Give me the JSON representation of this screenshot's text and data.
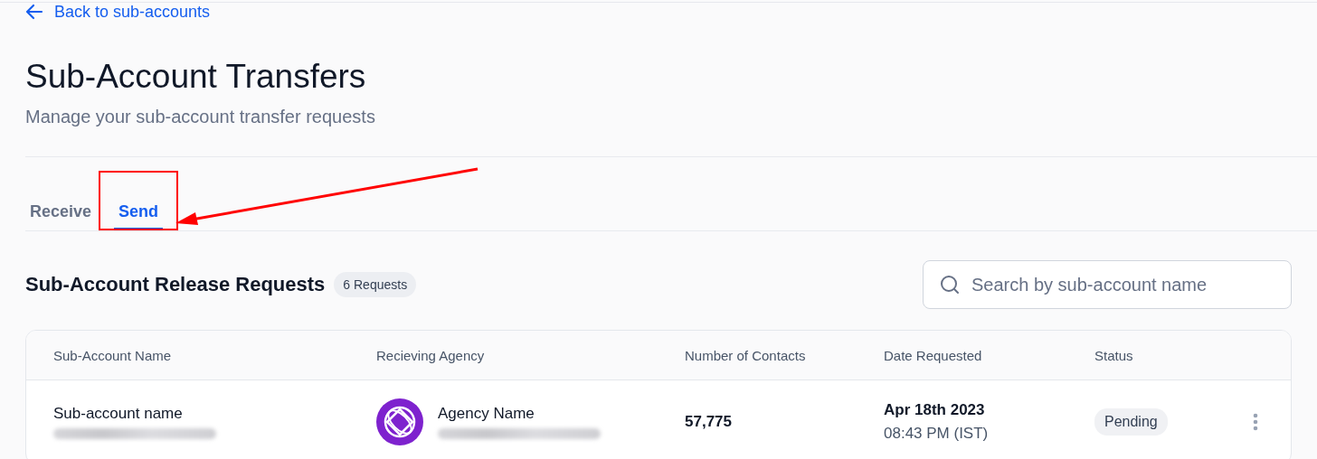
{
  "back_link": {
    "label": "Back to sub-accounts"
  },
  "page": {
    "title": "Sub-Account Transfers",
    "subtitle": "Manage your sub-account transfer requests"
  },
  "tabs": [
    {
      "label": "Receive",
      "selected": false,
      "highlighted": false
    },
    {
      "label": "Send",
      "selected": true,
      "highlighted": true
    }
  ],
  "section": {
    "title": "Sub-Account Release Requests",
    "count_badge": "6 Requests"
  },
  "search": {
    "placeholder": "Search by sub-account name"
  },
  "table": {
    "columns": [
      "Sub-Account Name",
      "Recieving Agency",
      "Number of Contacts",
      "Date Requested",
      "Status"
    ],
    "rows": [
      {
        "sub_account_name": "Sub-account name",
        "sub_account_email_redacted": true,
        "agency_name": "Agency Name",
        "agency_email_redacted": true,
        "contacts": "57,775",
        "date": "Apr 18th 2023",
        "time": "08:43 PM (IST)",
        "status": "Pending"
      }
    ]
  }
}
